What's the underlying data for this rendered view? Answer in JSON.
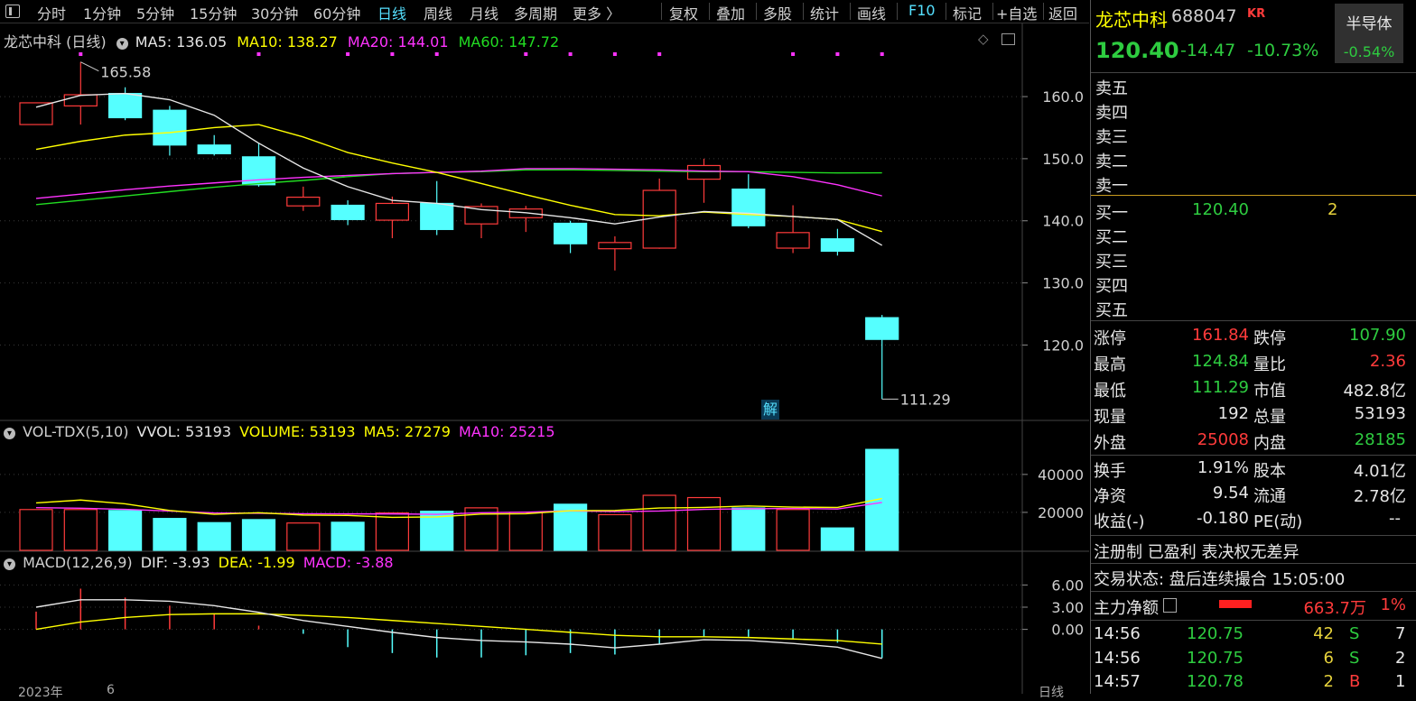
{
  "toolbar": {
    "periods": [
      "分时",
      "1分钟",
      "5分钟",
      "15分钟",
      "30分钟",
      "60分钟",
      "日线",
      "周线",
      "月线",
      "多周期",
      "更多 〉"
    ],
    "actions": [
      "复权",
      "叠加",
      "多股",
      "统计",
      "画线",
      "F10",
      "标记",
      "+自选",
      "返回"
    ]
  },
  "main_legend": {
    "title": "龙芯中科 (日线)",
    "ma5": "MA5: 136.05",
    "ma10": "MA10: 138.27",
    "ma20": "MA20: 144.01",
    "ma60": "MA60: 147.72"
  },
  "vol_legend": {
    "title": "VOL-TDX(5,10)",
    "vvol": "VVOL: 53193",
    "volume": "VOLUME: 53193",
    "ma5": "MA5: 27279",
    "ma10": "MA10: 25215"
  },
  "macd_legend": {
    "title": "MACD(12,26,9)",
    "dif": "DIF: -3.93",
    "dea": "DEA: -1.99",
    "macd": "MACD: -3.88"
  },
  "annotations": {
    "high": "165.58",
    "low": "111.29",
    "jie": "解"
  },
  "bottom": {
    "year": "2023年",
    "month": "6",
    "period": "日线"
  },
  "quote": {
    "name": "龙芯中科",
    "code": "688047",
    "tag": "KR",
    "sector": "半导体",
    "sector_change": "-0.54%",
    "price": "120.40",
    "change": "-14.47",
    "change_pct": "-10.73%"
  },
  "orderbook": {
    "asks": [
      "卖五",
      "卖四",
      "卖三",
      "卖二",
      "卖一"
    ],
    "bids": [
      {
        "label": "买一",
        "price": "120.40",
        "vol": "2"
      },
      {
        "label": "买二",
        "price": "",
        "vol": ""
      },
      {
        "label": "买三",
        "price": "",
        "vol": ""
      },
      {
        "label": "买四",
        "price": "",
        "vol": ""
      },
      {
        "label": "买五",
        "price": "",
        "vol": ""
      }
    ]
  },
  "stats": [
    {
      "l1": "涨停",
      "v1": "161.84",
      "c1": "red",
      "l2": "跌停",
      "v2": "107.90",
      "c2": "green"
    },
    {
      "l1": "最高",
      "v1": "124.84",
      "c1": "green",
      "l2": "量比",
      "v2": "2.36",
      "c2": "red"
    },
    {
      "l1": "最低",
      "v1": "111.29",
      "c1": "green",
      "l2": "市值",
      "v2": "482.8亿",
      "c2": "white"
    },
    {
      "l1": "现量",
      "v1": "192",
      "c1": "white",
      "l2": "总量",
      "v2": "53193",
      "c2": "white"
    },
    {
      "l1": "外盘",
      "v1": "25008",
      "c1": "red",
      "l2": "内盘",
      "v2": "28185",
      "c2": "green"
    }
  ],
  "stats2": [
    {
      "l1": "换手",
      "v1": "1.91%",
      "l2": "股本",
      "v2": "4.01亿"
    },
    {
      "l1": "净资",
      "v1": "9.54",
      "l2": "流通",
      "v2": "2.78亿"
    },
    {
      "l1": "收益(-)",
      "v1": "-0.180",
      "l2": "PE(动)",
      "v2": "--"
    }
  ],
  "info": {
    "tags": "注册制 已盈利 表决权无差异",
    "status": "交易状态: 盘后连续撮合 15:05:00",
    "flow_label": "主力净额",
    "flow_value": "663.7万",
    "flow_pct": "1%"
  },
  "ticks": [
    {
      "time": "14:56",
      "price": "120.75",
      "vol": "42",
      "side": "S",
      "n": "7"
    },
    {
      "time": "14:56",
      "price": "120.75",
      "vol": "6",
      "side": "S",
      "n": "2"
    },
    {
      "time": "14:57",
      "price": "120.78",
      "vol": "2",
      "side": "B",
      "n": "1"
    }
  ],
  "colors": {
    "up": "#ff3b3b",
    "down": "#55ffff",
    "ma5": "#e6e6e6",
    "ma10": "#ffff00",
    "ma20": "#ff33ff",
    "ma60": "#22dd22"
  },
  "chart_data": [
    {
      "type": "candlestick",
      "title": "龙芯中科 (日线)",
      "ylim": [
        108,
        168
      ],
      "yticks": [
        "160.0",
        "150.0",
        "140.0",
        "130.0",
        "120.0"
      ],
      "yvalues": [
        160,
        150,
        140,
        130,
        120
      ],
      "candles": [
        {
          "o": 155.5,
          "h": 159,
          "l": 155.5,
          "c": 159
        },
        {
          "o": 158.5,
          "h": 165.58,
          "l": 155.5,
          "c": 160.3
        },
        {
          "o": 160.5,
          "h": 161.5,
          "l": 156.2,
          "c": 156.6
        },
        {
          "o": 157.8,
          "h": 158.5,
          "l": 150.5,
          "c": 152.2
        },
        {
          "o": 152.2,
          "h": 153.8,
          "l": 150.5,
          "c": 150.8
        },
        {
          "o": 150.3,
          "h": 152.5,
          "l": 145.5,
          "c": 145.8
        },
        {
          "o": 142.4,
          "h": 145.5,
          "l": 141.6,
          "c": 143.8
        },
        {
          "o": 142.5,
          "h": 143.3,
          "l": 139.3,
          "c": 140.2
        },
        {
          "o": 140.1,
          "h": 143.9,
          "l": 137.2,
          "c": 142.8
        },
        {
          "o": 142.8,
          "h": 146.4,
          "l": 137.7,
          "c": 138.6
        },
        {
          "o": 139.5,
          "h": 142.8,
          "l": 137.2,
          "c": 142.3
        },
        {
          "o": 140.5,
          "h": 142.4,
          "l": 138.2,
          "c": 141.9
        },
        {
          "o": 139.6,
          "h": 140,
          "l": 134.8,
          "c": 136.3
        },
        {
          "o": 135.5,
          "h": 137.5,
          "l": 132,
          "c": 136.5
        },
        {
          "o": 135.6,
          "h": 146.8,
          "l": 135.5,
          "c": 144.9
        },
        {
          "o": 146.7,
          "h": 150,
          "l": 142.9,
          "c": 148.9
        },
        {
          "o": 145.1,
          "h": 147.5,
          "l": 138.8,
          "c": 139.2
        },
        {
          "o": 135.6,
          "h": 142.5,
          "l": 134.8,
          "c": 138.1
        },
        {
          "o": 137.1,
          "h": 138.7,
          "l": 134.4,
          "c": 135.1
        },
        {
          "o": 124.4,
          "h": 124.84,
          "l": 111.29,
          "c": 120.9
        }
      ],
      "ma5": [
        158.3,
        160.2,
        160.5,
        159.5,
        157,
        152.5,
        148.5,
        145.5,
        143.3,
        142.8,
        141.8,
        141.3,
        140.5,
        139.5,
        140.6,
        141.5,
        141.2,
        140.7,
        140.2,
        136.05
      ],
      "ma10": [
        151.5,
        152.8,
        153.8,
        154.2,
        155,
        155.5,
        153.5,
        151,
        149.3,
        147.8,
        146,
        144.2,
        142.5,
        141,
        140.8,
        141.4,
        141,
        140.7,
        140.2,
        138.27
      ],
      "ma20": [
        143.6,
        144.3,
        145,
        145.6,
        146.1,
        146.6,
        147,
        147.3,
        147.6,
        147.8,
        148,
        148.4,
        148.4,
        148.3,
        148.2,
        148,
        147.9,
        147.1,
        145.8,
        144.01
      ],
      "ma60": [
        142.6,
        143.3,
        144,
        144.7,
        145.4,
        146,
        146.5,
        147.1,
        147.6,
        147.8,
        147.9,
        148.2,
        148.2,
        148.1,
        148,
        147.9,
        147.9,
        147.8,
        147.7,
        147.72
      ]
    },
    {
      "type": "bar",
      "title": "VOL-TDX(5,10)",
      "ylim": [
        0,
        58000
      ],
      "yticks": [
        "40000",
        "20000"
      ],
      "yvalues": [
        40000,
        20000
      ],
      "values": [
        21500,
        21500,
        21000,
        16800,
        14600,
        16200,
        14400,
        14800,
        19700,
        20600,
        22400,
        20000,
        24300,
        18800,
        29000,
        27800,
        22300,
        21500,
        11800,
        53193
      ],
      "ma5": [
        25000,
        26500,
        24500,
        21000,
        19000,
        19800,
        18600,
        18400,
        17400,
        17600,
        19100,
        19300,
        20900,
        21000,
        22300,
        22600,
        23400,
        22800,
        22600,
        27279
      ],
      "ma10": [
        22500,
        22200,
        21600,
        20700,
        19700,
        19500,
        19300,
        19200,
        19200,
        19000,
        19800,
        20100,
        20800,
        20400,
        20700,
        21600,
        21900,
        22100,
        21800,
        25215
      ]
    },
    {
      "type": "line",
      "title": "MACD(12,26,9)",
      "ylim": [
        -7,
        8
      ],
      "yticks": [
        "6.00",
        "3.00",
        "0.00"
      ],
      "yvalues": [
        6,
        3,
        0
      ],
      "dif": [
        3,
        4,
        4,
        3.8,
        3.2,
        2.3,
        1.2,
        0.4,
        -0.4,
        -1.1,
        -1.5,
        -1.7,
        -2,
        -2.5,
        -2,
        -1.4,
        -1.5,
        -1.9,
        -2.4,
        -3.93
      ],
      "dea": [
        0,
        1,
        1.6,
        2,
        2.1,
        2.1,
        1.9,
        1.6,
        1.2,
        0.8,
        0.4,
        0,
        -0.4,
        -0.8,
        -1,
        -1,
        -1.1,
        -1.3,
        -1.5,
        -1.99
      ],
      "macd": [
        2.4,
        5.5,
        4.3,
        3.2,
        2.1,
        0.5,
        -0.6,
        -2.4,
        -3.2,
        -3.8,
        -3.8,
        -3.5,
        -3.2,
        -3.4,
        -2,
        -1,
        -1,
        -1.2,
        -1.8,
        -3.88
      ]
    }
  ]
}
